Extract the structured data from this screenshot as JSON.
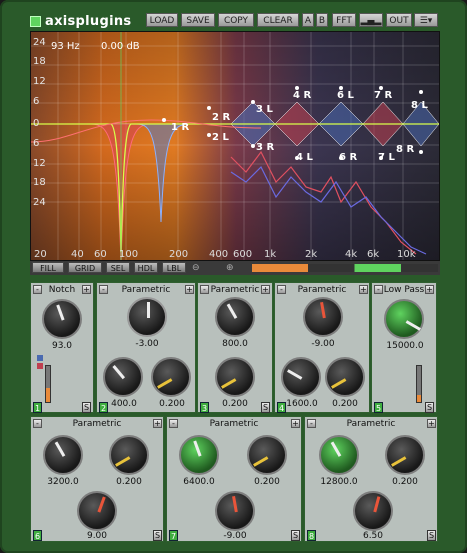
{
  "brand": "axisplugins",
  "toolbar": {
    "load": "LOAD",
    "save": "SAVE",
    "copy": "COPY",
    "clear": "CLEAR",
    "a": "A",
    "b": "B",
    "fft": "FFT",
    "out": "OUT"
  },
  "readout": {
    "freq": "93 Hz",
    "gain": "0.00 dB"
  },
  "y_ticks": [
    "24",
    "18",
    "12",
    "6",
    "0",
    "6",
    "12",
    "18",
    "24"
  ],
  "x_ticks": [
    "20",
    "40",
    "60",
    "100",
    "200",
    "400",
    "600",
    "1k",
    "2k",
    "4k",
    "6k",
    "10k"
  ],
  "band_labels": [
    "1 R",
    "2 R",
    "2 L",
    "3 L",
    "3 R",
    "4 R",
    "4 L",
    "6 L",
    "6 R",
    "7 R",
    "7 L",
    "8 L",
    "8 R"
  ],
  "display_buttons": {
    "fill": "FILL",
    "grid": "GRID",
    "sel": "SEL",
    "hdl": "HDL",
    "lbl": "LBL"
  },
  "bands": [
    {
      "num": "1",
      "type": "Notch",
      "k1": "93.0",
      "knob1_color": "#e8e8e8"
    },
    {
      "num": "2",
      "type": "Parametric",
      "k1": "-3.00",
      "k2": "400.0",
      "k3": "0.200"
    },
    {
      "num": "3",
      "type": "Parametric",
      "k1": "800.0",
      "k2": "0.200"
    },
    {
      "num": "4",
      "type": "Parametric",
      "k1": "-9.00",
      "k2": "1600.0",
      "k3": "0.200"
    },
    {
      "num": "5",
      "type": "Low Pass",
      "k1": "15000.0"
    },
    {
      "num": "6",
      "type": "Parametric",
      "k1": "3200.0",
      "k2": "0.200",
      "k3": "9.00"
    },
    {
      "num": "7",
      "type": "Parametric",
      "k1": "6400.0",
      "k2": "0.200",
      "k3": "-9.00"
    },
    {
      "num": "8",
      "type": "Parametric",
      "k1": "12800.0",
      "k2": "0.200",
      "k3": "6.50"
    }
  ],
  "s_label": "S",
  "plus": "+",
  "minus": "-",
  "colors": {
    "panel_bg": "#b8c0bc",
    "chrome": "#2a5a2a",
    "accent_orange": "#e98a3a",
    "accent_green": "#3fae3f"
  }
}
